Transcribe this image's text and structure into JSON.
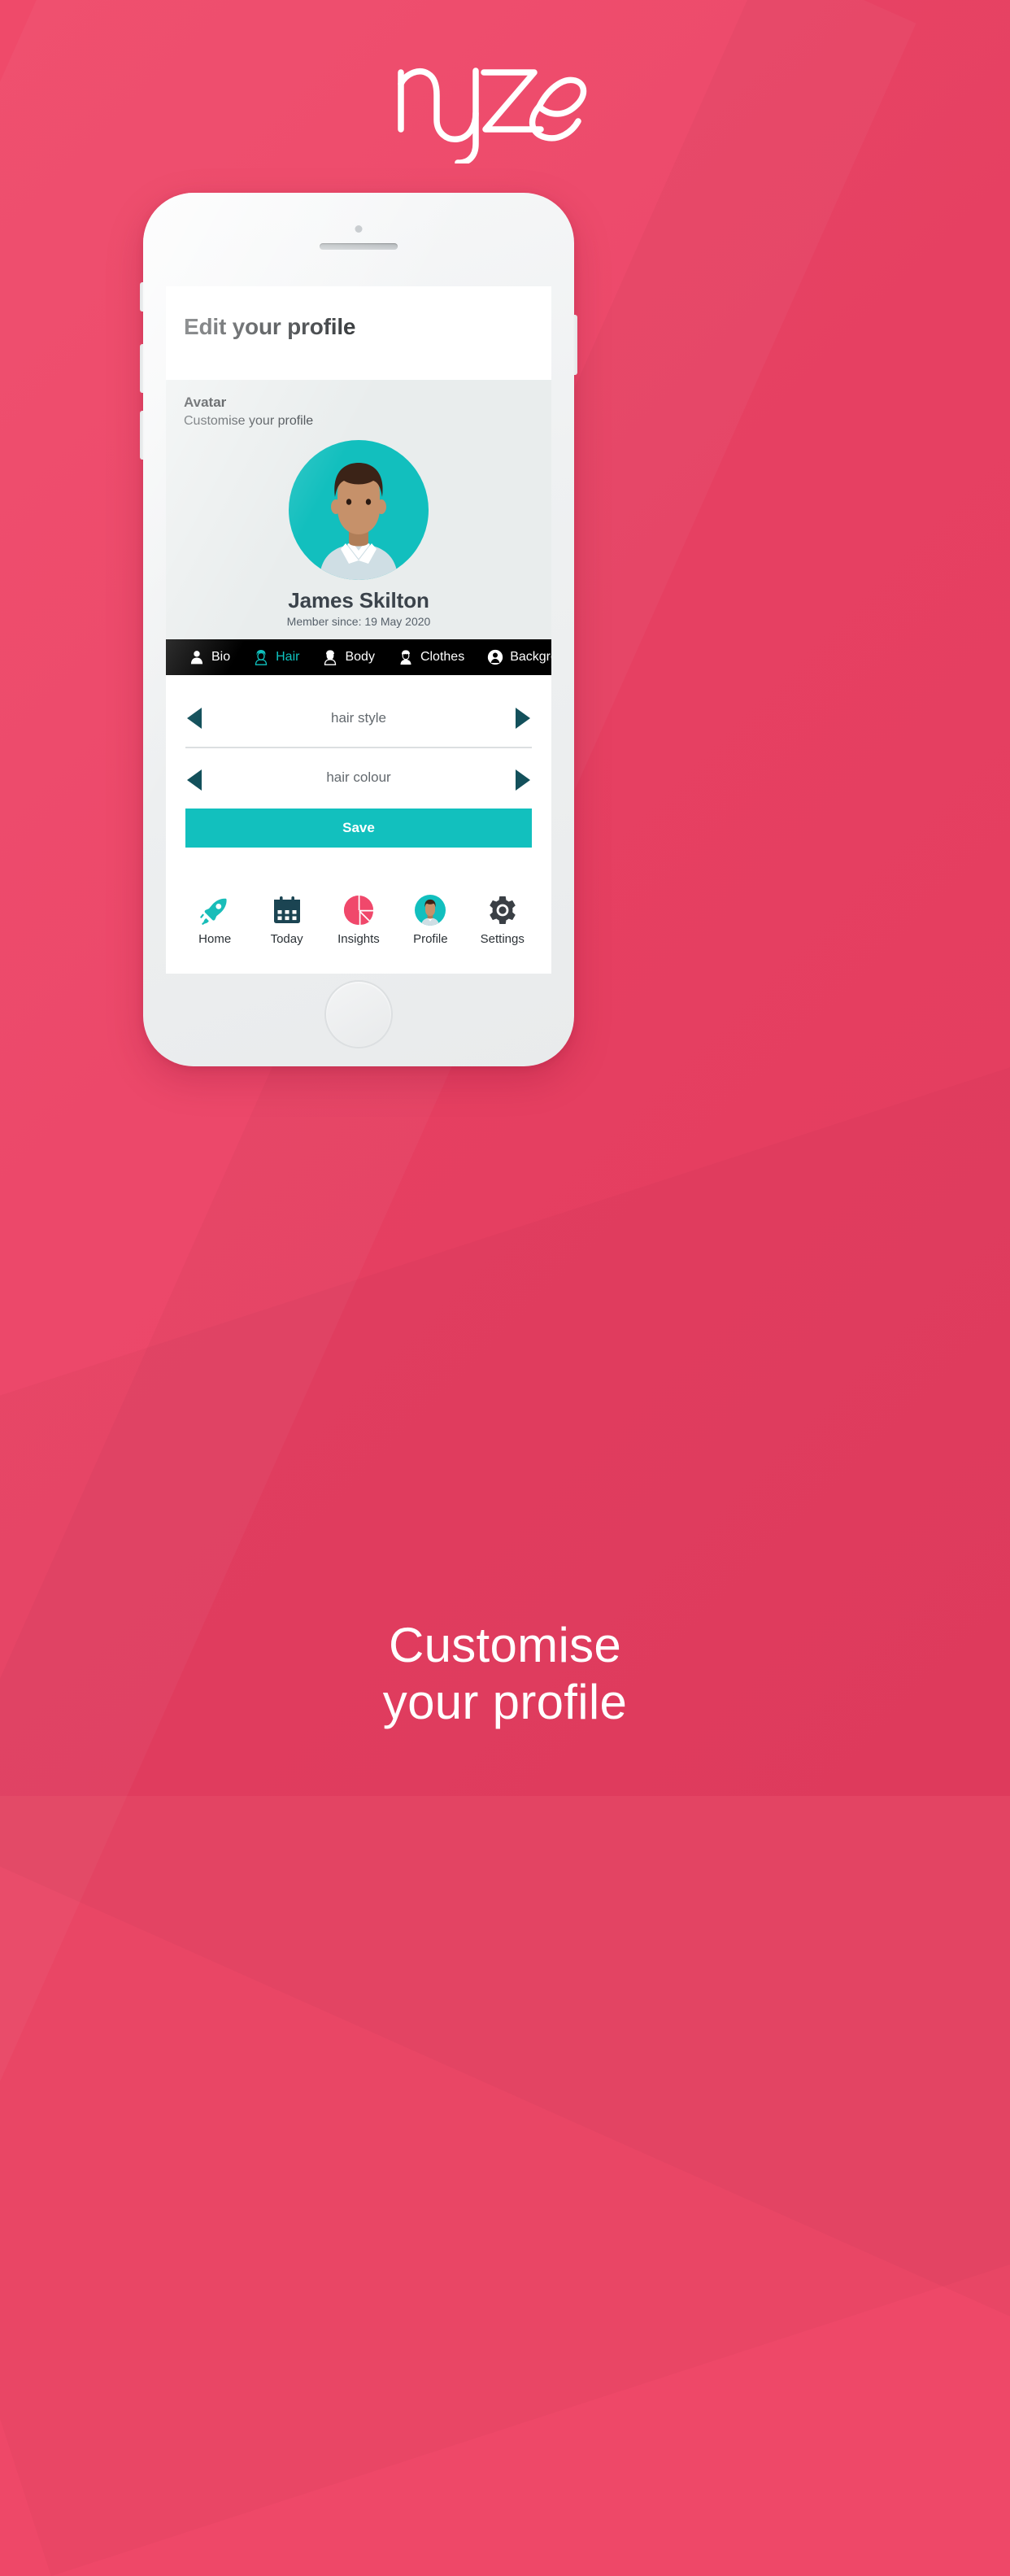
{
  "brand": {
    "logo_text": "ryze",
    "background_color": "#EC4265",
    "accent_teal": "#12C0BE",
    "accent_pink": "#EE4868",
    "dark_navy": "#13505B"
  },
  "caption": {
    "line1": "Customise",
    "line2": "your profile"
  },
  "phone": {
    "speaker_icon": "speaker-grill",
    "camera_icon": "front-camera",
    "home_button_icon": "home-button"
  },
  "screen": {
    "header": {
      "title": "Edit your profile"
    },
    "avatar_section": {
      "heading": "Avatar",
      "subheading": "Customise your profile",
      "avatar_icon": "user-avatar-illustration",
      "name": "James Skilton",
      "member_since": "Member since: 19 May 2020",
      "circle_color": "#12BFBE",
      "skin_color": "#C6916A",
      "hair_color": "#3B2317",
      "shirt_color": "#CFDEE4"
    },
    "tabs": [
      {
        "label": "Bio",
        "icon": "person-icon",
        "active": false
      },
      {
        "label": "Hair",
        "icon": "hair-icon",
        "active": true
      },
      {
        "label": "Body",
        "icon": "body-icon",
        "active": false
      },
      {
        "label": "Clothes",
        "icon": "clothes-icon",
        "active": false
      },
      {
        "label": "Background",
        "icon": "background-icon",
        "active": false
      }
    ],
    "selectors": [
      {
        "label": "hair style",
        "prev_icon": "arrow-left-icon",
        "next_icon": "arrow-right-icon"
      },
      {
        "label": "hair colour",
        "prev_icon": "arrow-left-icon",
        "next_icon": "arrow-right-icon"
      }
    ],
    "save_button": {
      "label": "Save"
    },
    "bottom_nav": [
      {
        "label": "Home",
        "icon": "rocket-icon"
      },
      {
        "label": "Today",
        "icon": "calendar-icon"
      },
      {
        "label": "Insights",
        "icon": "pie-chart-icon"
      },
      {
        "label": "Profile",
        "icon": "avatar-icon"
      },
      {
        "label": "Settings",
        "icon": "gear-icon"
      }
    ]
  }
}
